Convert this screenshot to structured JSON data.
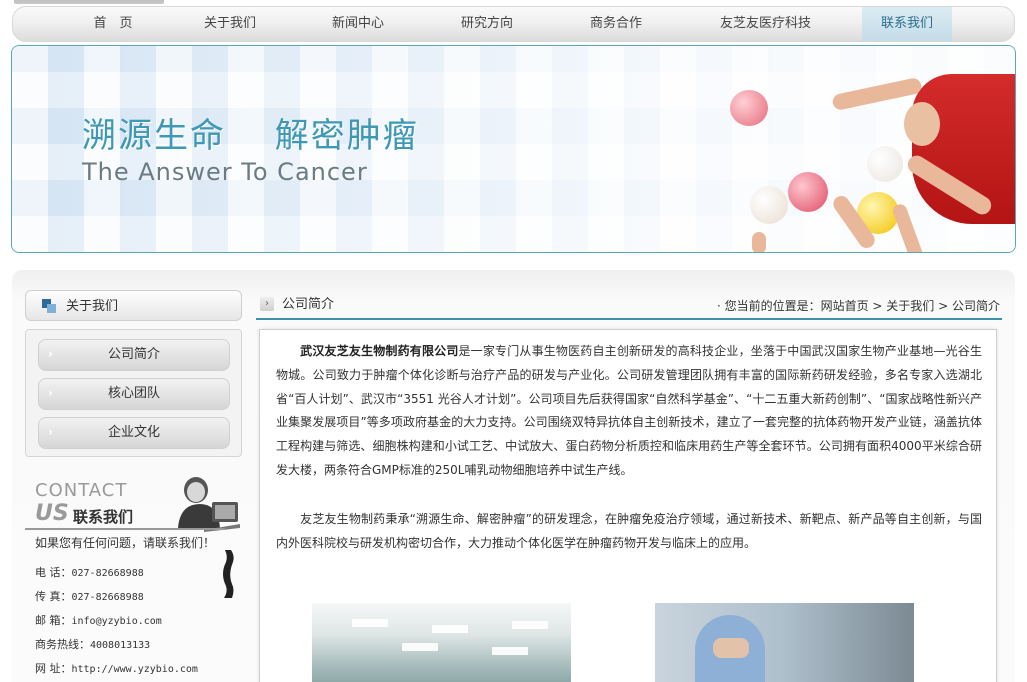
{
  "nav": {
    "items": [
      "首　页",
      "关于我们",
      "新闻中心",
      "研究方向",
      "商务合作",
      "友芝友医疗科技",
      "联系我们"
    ],
    "active_index": 6
  },
  "banner": {
    "title": "溯源生命　 解密肿瘤",
    "subtitle": "The Answer To Cancer"
  },
  "sidebar": {
    "title": "关于我们",
    "menu": [
      "公司简介",
      "核心团队",
      "企业文化"
    ],
    "contact": {
      "title_en": "CONTACT",
      "us": "US",
      "title_cn": "联系我们",
      "ask": "如果您有任何问题，请联系我们！",
      "rows": [
        {
          "label": "电  话：",
          "value": "027-82668988"
        },
        {
          "label": "传  真：",
          "value": "027-82668988"
        },
        {
          "label": "邮  箱：",
          "value": "info@yzybio.com"
        },
        {
          "label": "商务热线：",
          "value": "4008013133"
        },
        {
          "label": "网  址：",
          "value": "http://www.yzybio.com"
        }
      ]
    }
  },
  "main": {
    "section_title": "公司简介",
    "breadcrumb_prefix": "· 您当前的位置是：",
    "breadcrumb": [
      "网站首页",
      "关于我们",
      "公司简介"
    ],
    "company_name": "武汉友芝友生物制药有限公司",
    "para1": "是一家专门从事生物医药自主创新研发的高科技企业，坐落于中国武汉国家生物产业基地—光谷生物城。公司致力于肿瘤个体化诊断与治疗产品的研发与产业化。公司研发管理团队拥有丰富的国际新药研发经验，多名专家入选湖北省“百人计划”、武汉市“3551 光谷人才计划”。公司项目先后获得国家“自然科学基金”、“十二五重大新药创制”、“国家战略性新兴产业集聚发展项目”等多项政府基金的大力支持。公司围绕双特异抗体自主创新技术，建立了一套完整的抗体药物开发产业链，涵盖抗体工程构建与筛选、细胞株构建和小试工艺、中试放大、蛋白药物分析质控和临床用药生产等全套环节。公司拥有面积4000平米综合研发大楼，两条符合GMP标准的250L哺乳动物细胞培养中试生产线。",
    "para2": "友芝友生物制药秉承“溯源生命、解密肿瘤”的研发理念，在肿瘤免疫治疗领域，通过新技术、新靶点、新产品等自主创新，与国内外医科院校与研发机构密切合作，大力推动个体化医学在肿瘤药物开发与临床上的应用。"
  },
  "colors": {
    "accent": "#3e8faa",
    "banner_title": "#3f98b4"
  }
}
